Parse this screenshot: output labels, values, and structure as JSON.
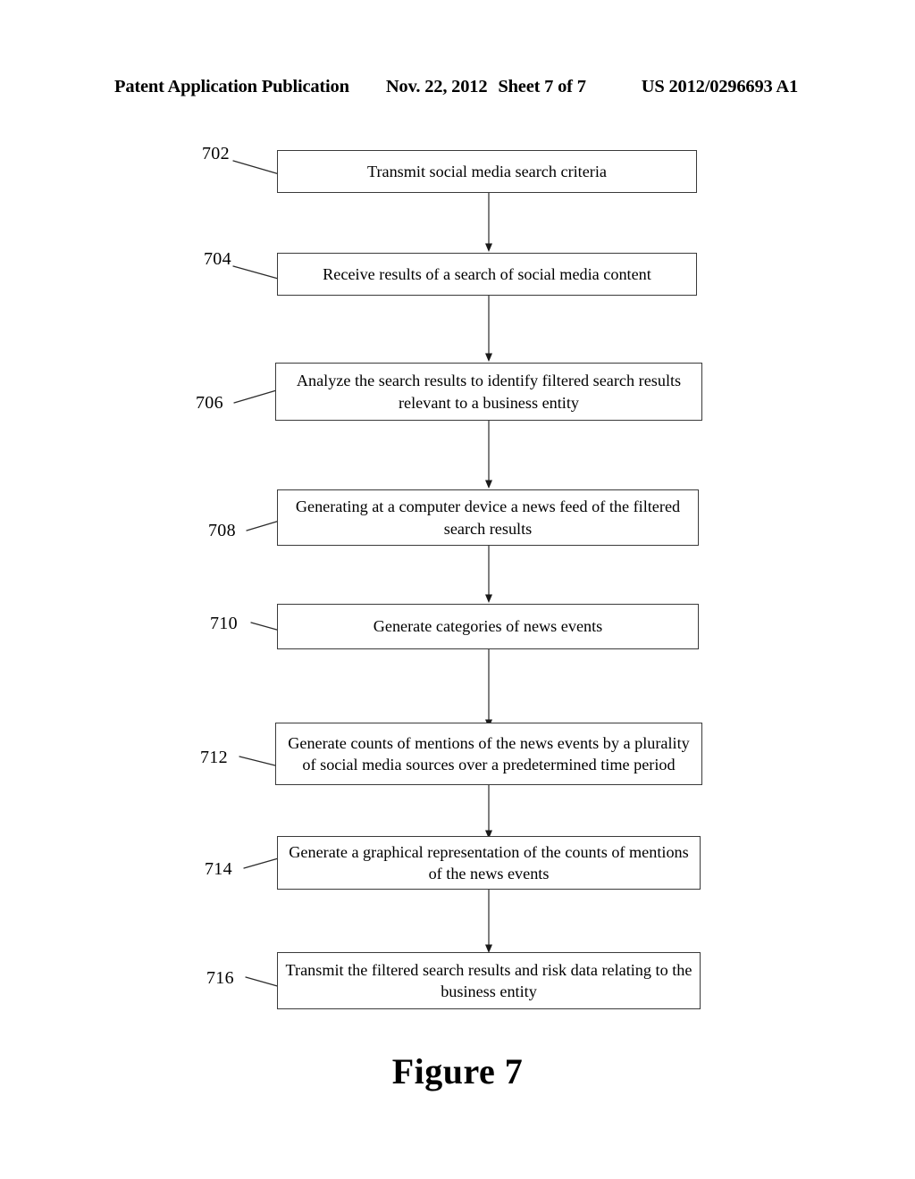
{
  "header": {
    "publication": "Patent Application Publication",
    "date": "Nov. 22, 2012",
    "sheet": "Sheet 7 of 7",
    "patent_number": "US 2012/0296693 A1"
  },
  "figure": {
    "caption": "Figure 7",
    "type": "flowchart",
    "line_color": "#3a3a3a",
    "background_color": "#ffffff"
  },
  "flowchart": {
    "steps": [
      {
        "ref": "702",
        "text": "Transmit social media search criteria",
        "lines": 1
      },
      {
        "ref": "704",
        "text": "Receive results of a search of social media content",
        "lines": 1
      },
      {
        "ref": "706",
        "text": "Analyze the search results to identify filtered search results relevant to a business entity",
        "lines": 2
      },
      {
        "ref": "708",
        "text": "Generating at a computer device a news feed of the filtered search results",
        "lines": 2
      },
      {
        "ref": "710",
        "text": "Generate categories of news events",
        "lines": 1
      },
      {
        "ref": "712",
        "text": "Generate counts of mentions of the news events by a plurality of social media sources over a predetermined time period",
        "lines": 2
      },
      {
        "ref": "714",
        "text": "Generate a graphical representation of the counts of mentions of the news events",
        "lines": 2
      },
      {
        "ref": "716",
        "text": "Transmit the filtered search results and risk data relating to the business entity",
        "lines": 2
      }
    ]
  }
}
